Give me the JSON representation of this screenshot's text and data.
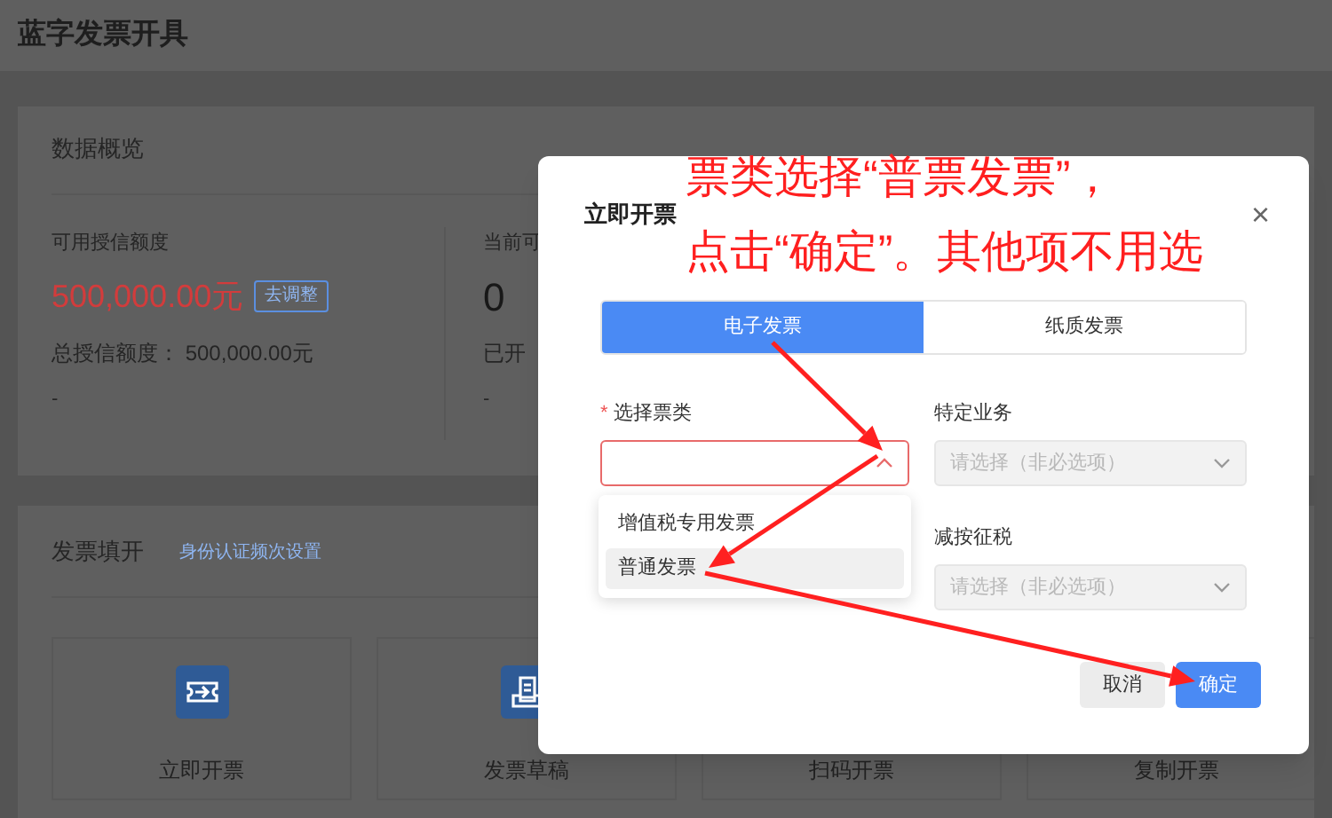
{
  "header": {
    "title": "蓝字发票开具"
  },
  "overview": {
    "title": "数据概览",
    "stats": [
      {
        "label": "可用授信额度",
        "value": "500,000.00元",
        "action": "去调整",
        "detail": "总授信额度： 500,000.00元",
        "note": "-"
      },
      {
        "label": "当前可",
        "value": "0",
        "detail": "已开",
        "note": "-"
      }
    ]
  },
  "issue_panel": {
    "title": "发票填开",
    "link": "身份认证频次设置",
    "tiles": [
      {
        "label": "立即开票"
      },
      {
        "label": "发票草稿"
      },
      {
        "label": "扫码开票"
      },
      {
        "label": "复制开票"
      }
    ]
  },
  "dialog": {
    "title": "立即开票",
    "close": "×",
    "tabs": [
      {
        "label": "电子发票",
        "selected": true
      },
      {
        "label": "纸质发票",
        "selected": false
      }
    ],
    "fields": [
      {
        "label": "选择票类",
        "required_mark": "*",
        "expanded": true,
        "disabled": false
      },
      {
        "label": "特定业务",
        "placeholder": "请选择（非必选项）",
        "expanded": false,
        "disabled": true
      },
      {
        "label": "减按征税",
        "placeholder": "请选择（非必选项）",
        "expanded": false,
        "disabled": true
      }
    ],
    "dropdown": [
      {
        "label": "增值税专用发票",
        "selected": false
      },
      {
        "label": "普通发票",
        "selected": true
      }
    ],
    "buttons": [
      {
        "label": "取消",
        "kind": "secondary"
      },
      {
        "label": "确定",
        "kind": "primary"
      }
    ]
  },
  "annotation": {
    "lines": [
      "票类选择“普票发票”，",
      "点击“确定”。其他项不用选"
    ]
  }
}
